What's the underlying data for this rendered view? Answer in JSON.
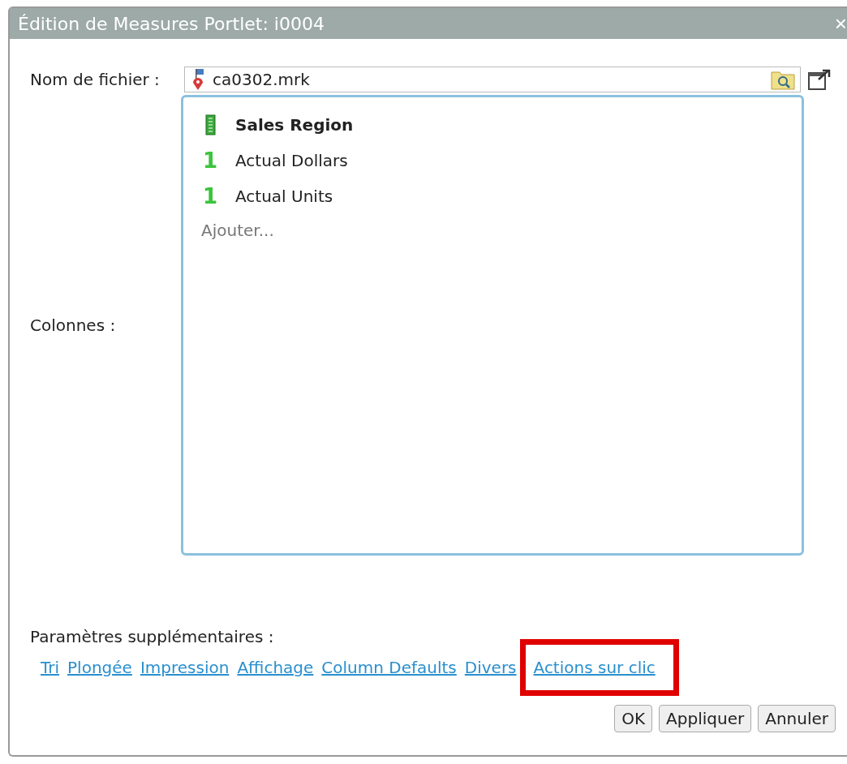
{
  "window": {
    "title": "Édition de Measures Portlet: i0004",
    "close": "×"
  },
  "file": {
    "label": "Nom de fichier :",
    "value": "ca0302.mrk"
  },
  "columns": {
    "label": "Colonnes :",
    "items": [
      {
        "kind": "dimension",
        "label": "Sales Region"
      },
      {
        "kind": "measure",
        "icon_text": "1",
        "label": "Actual Dollars"
      },
      {
        "kind": "measure",
        "icon_text": "1",
        "label": "Actual Units"
      }
    ],
    "add": "Ajouter..."
  },
  "extra": {
    "label": "Paramètres supplémentaires :",
    "links": [
      {
        "label": "Tri",
        "highlighted": false
      },
      {
        "label": "Plongée",
        "highlighted": false
      },
      {
        "label": "Impression",
        "highlighted": false
      },
      {
        "label": "Affichage",
        "highlighted": false
      },
      {
        "label": "Column Defaults",
        "highlighted": false
      },
      {
        "label": "Divers",
        "highlighted": false
      },
      {
        "label": "Actions sur clic",
        "highlighted": true
      }
    ]
  },
  "buttons": [
    "OK",
    "Appliquer",
    "Annuler"
  ]
}
